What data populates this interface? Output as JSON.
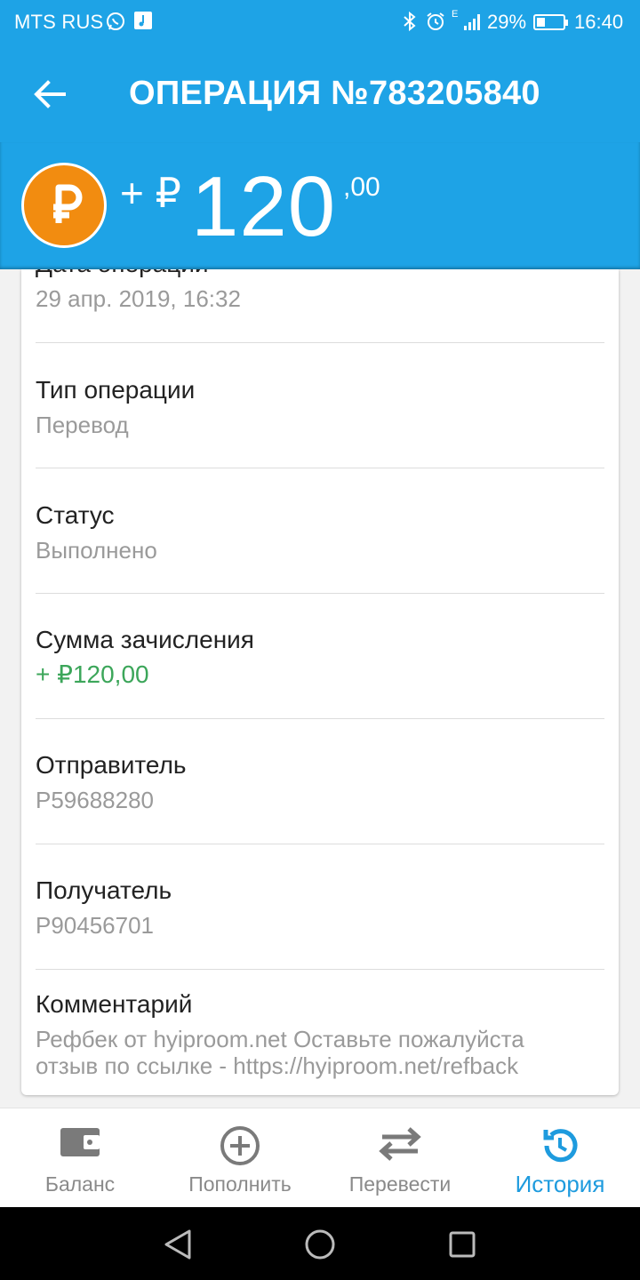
{
  "status_bar": {
    "carrier": "MTS RUS",
    "battery_percent": "29%",
    "time": "16:40",
    "network_type": "E"
  },
  "app_bar": {
    "title": "ОПЕРАЦИЯ №783205840",
    "back_icon": "arrow-left-icon"
  },
  "amount": {
    "sign": "+ ₽",
    "integer": "120",
    "cents": ",00",
    "coin_icon": "ruble-coin-icon",
    "coin_color": "#f28c10"
  },
  "details": {
    "date_label": "Дата операции",
    "date_value": "29 апр. 2019, 16:32",
    "type_label": "Тип операции",
    "type_value": "Перевод",
    "status_label": "Статус",
    "status_value": "Выполнено",
    "credit_label": "Сумма зачисления",
    "credit_value": "+ ₽120,00",
    "sender_label": "Отправитель",
    "sender_value": "P59688280",
    "recipient_label": "Получатель",
    "recipient_value": "P90456701",
    "comment_label": "Комментарий",
    "comment_line1": "Рефбек от hyiproom.net  Оставьте пожалуйста",
    "comment_line2": "отзыв по ссылке - https://hyiproom.net/refback"
  },
  "bottom_nav": {
    "items": [
      {
        "label": "Баланс",
        "icon": "wallet-icon"
      },
      {
        "label": "Пополнить",
        "icon": "plus-circle-icon"
      },
      {
        "label": "Перевести",
        "icon": "transfer-arrows-icon"
      },
      {
        "label": "История",
        "icon": "history-icon"
      }
    ],
    "active_index": 3
  },
  "colors": {
    "primary": "#1ea3e6",
    "active_nav": "#1e9bde",
    "credit_green": "#3ca65a"
  }
}
